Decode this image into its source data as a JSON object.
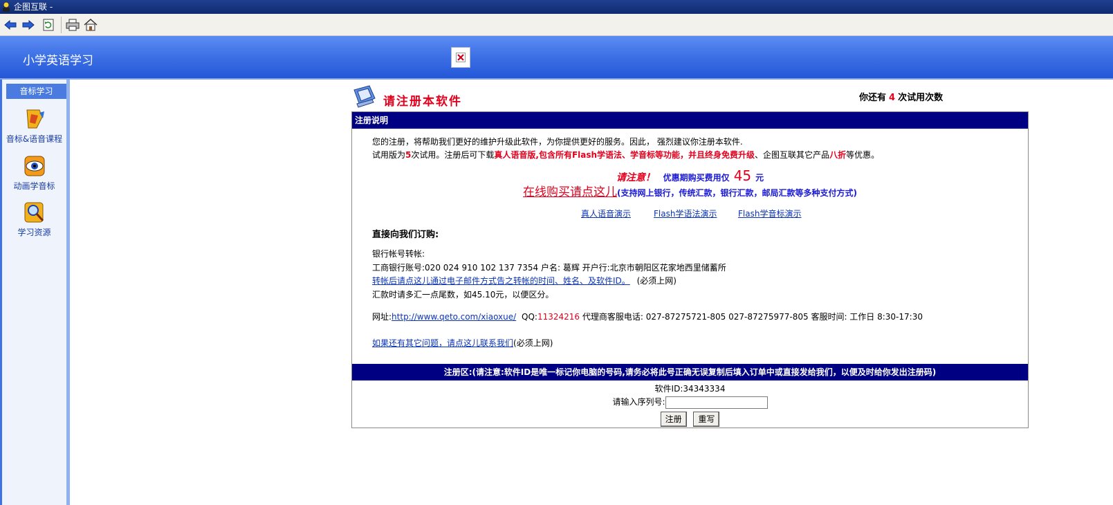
{
  "window": {
    "title": "企图互联 -"
  },
  "toolbar": {
    "icons": [
      "back-icon",
      "forward-icon",
      "refresh-icon",
      "print-icon",
      "home-icon"
    ]
  },
  "header": {
    "app_title": "小学英语学习"
  },
  "sidebar": {
    "heading": "音标学习",
    "items": [
      {
        "label": "音标&语音课程",
        "icon": "course-icon"
      },
      {
        "label": "动画学音标",
        "icon": "animation-eye-icon"
      },
      {
        "label": "学习资源",
        "icon": "resources-search-icon"
      }
    ]
  },
  "main": {
    "reg_title": "请注册本软件",
    "trial": {
      "prefix": "你还有",
      "count": "4",
      "suffix": "次试用次数"
    },
    "section1_title": "注册说明",
    "intro_line1": "您的注册，将帮助我们更好的维护升级此软件，为你提供更好的服务。因此， 强烈建议你注册本软件.",
    "intro_line2": {
      "a": "试用版为",
      "b": "5",
      "c": "次试用。注册后可下载",
      "d": "真人语音版,包含所有Flash学语法、学音标等功能，并且终身免费升级",
      "e": "、企图互联其它产品",
      "f": "八折",
      "g": "等优惠。"
    },
    "notice": {
      "attention": "请注意！",
      "offer": "优惠期购买费用仅",
      "price": "45",
      "unit": "元"
    },
    "buy_link": "在线购买请点这儿",
    "payment_methods": "(支持网上银行，传统汇款，银行汇款，邮局汇款等多种支付方式)",
    "demos": [
      "真人语音演示",
      "Flash学语法演示",
      "Flash学音标演示"
    ],
    "order_heading": "直接向我们订购:",
    "bank_heading": "银行帐号转帐:",
    "bank_info": "工商银行账号:020 024 910 102 137 7354 户名: 葛辉 开户行:北京市朝阳区花家地西里储蓄所",
    "transfer_link": "转帐后请点这儿通过电子邮件方式告之转帐的时间、姓名、及软件ID。",
    "transfer_note": "(必须上网)",
    "remit_note": "汇款时请多汇一点尾数，如45.10元，以便区分。",
    "contact": {
      "site_label": "网址:",
      "site_url": "http://www.qeto.com/xiaoxue/",
      "qq_label": "QQ:",
      "qq": "11324216",
      "rest": "代理商客服电话: 027-87275721-805 027-87275977-805 客服时间: 工作日 8:30-17:30"
    },
    "question_link": "如果还有其它问题，请点这儿联系我们",
    "question_note": "(必须上网)",
    "section2_title": "注册区:(请注意:软件ID是唯一标记你电脑的号码,请务必将此号正确无误复制后填入订单中或直接发给我们，以便及时给你发出注册码)",
    "software_id": "软件ID:34343334",
    "serial_label": "请输入序列号:",
    "serial_value": "",
    "register_button": "注册",
    "reset_button": "重写"
  },
  "colors": {
    "header_blue": "#3f72e6",
    "bar_navy": "#000083",
    "accent_red": "#e4001c"
  }
}
